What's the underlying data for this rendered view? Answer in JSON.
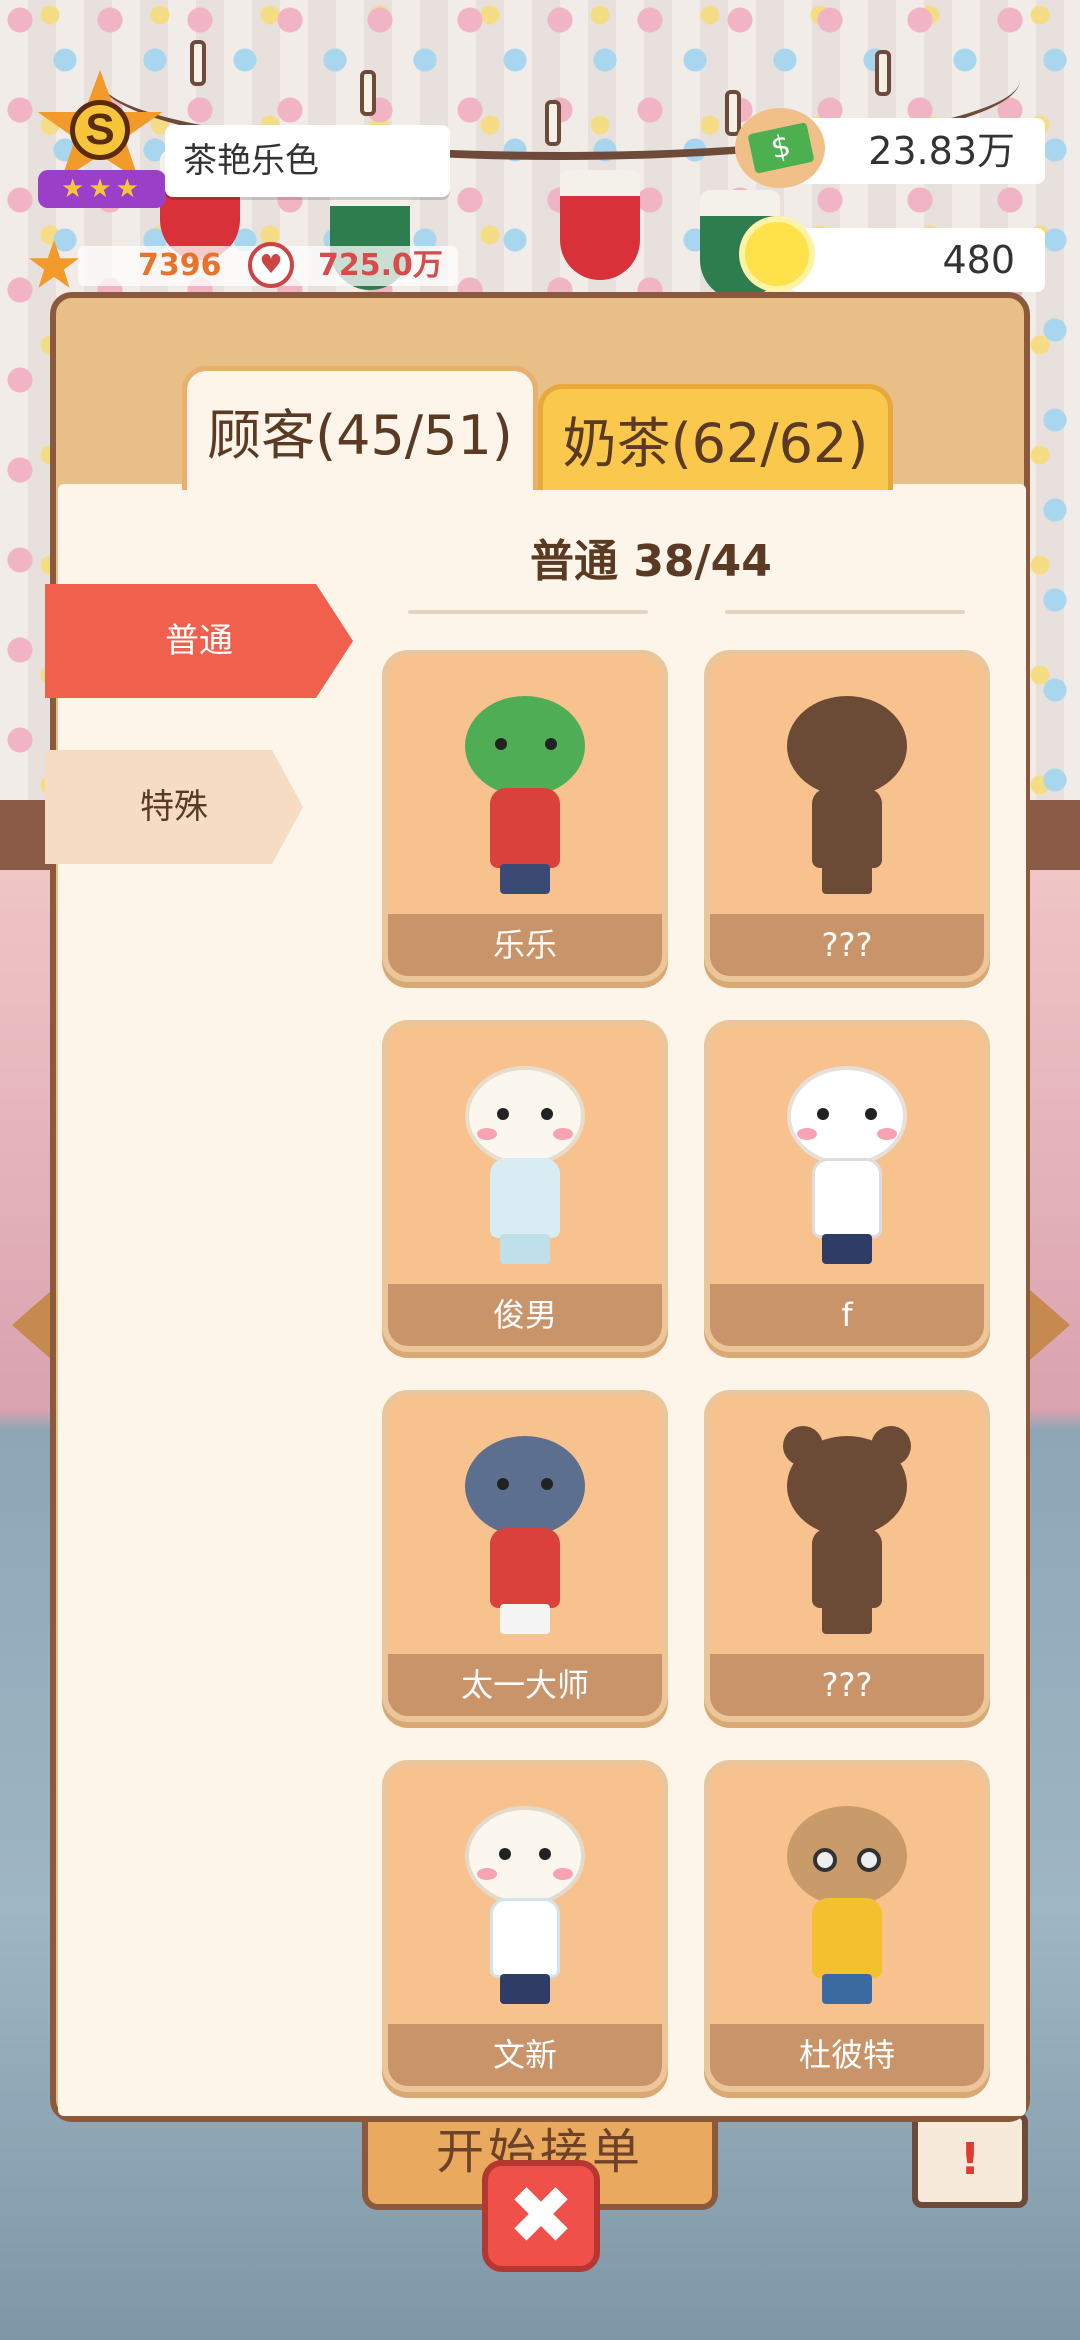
{
  "player": {
    "rank_letter": "S",
    "rank_stars": "★★★",
    "name": "茶艳乐色",
    "stars": "7396",
    "fans": "725.0万"
  },
  "resources": {
    "money": "23.83万",
    "ideas": "480"
  },
  "tabs": [
    {
      "label": "顾客(45/51)",
      "active": true
    },
    {
      "label": "奶茶(62/62)",
      "active": false
    }
  ],
  "categories": [
    {
      "label": "普通",
      "active": true
    },
    {
      "label": "特殊",
      "active": false
    }
  ],
  "section_title": "普通 38/44",
  "cards": [
    {
      "name": "乐乐",
      "unlocked": true
    },
    {
      "name": "???",
      "unlocked": false
    },
    {
      "name": "俊男",
      "unlocked": true
    },
    {
      "name": "f",
      "unlocked": true
    },
    {
      "name": "太一大师",
      "unlocked": true
    },
    {
      "name": "???",
      "unlocked": false
    },
    {
      "name": "文新",
      "unlocked": true
    },
    {
      "name": "杜彼特",
      "unlocked": true
    }
  ],
  "bottom": {
    "start_label": "开始接单",
    "close_icon": "close-icon",
    "notice_mark": "!"
  },
  "colors": {
    "accent_red": "#f0604c",
    "card_bg": "#f8c28f",
    "panel_border": "#8b5a3c"
  }
}
